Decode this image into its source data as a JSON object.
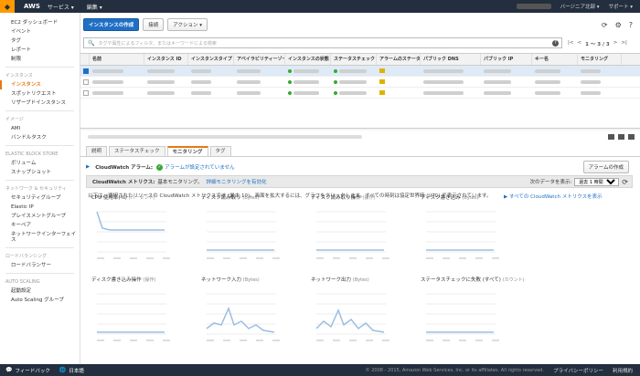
{
  "topbar": {
    "brand": "AWS",
    "services": "サービス ▾",
    "edit": "編集 ▾",
    "region": "バージニア北部 ▾",
    "support": "サポート ▾"
  },
  "sidebar": {
    "items": [
      {
        "label": "EC2 ダッシュボード",
        "type": "item"
      },
      {
        "label": "イベント",
        "type": "item"
      },
      {
        "label": "タグ",
        "type": "item"
      },
      {
        "label": "レポート",
        "type": "item"
      },
      {
        "label": "制限",
        "type": "item"
      },
      {
        "label": "インスタンス",
        "type": "head"
      },
      {
        "label": "インスタンス",
        "type": "active"
      },
      {
        "label": "スポットリクエスト",
        "type": "item"
      },
      {
        "label": "リザーブドインスタンス",
        "type": "item"
      },
      {
        "label": "イメージ",
        "type": "head"
      },
      {
        "label": "AMI",
        "type": "item"
      },
      {
        "label": "バンドルタスク",
        "type": "item"
      },
      {
        "label": "ELASTIC BLOCK STORE",
        "type": "head"
      },
      {
        "label": "ボリューム",
        "type": "item"
      },
      {
        "label": "スナップショット",
        "type": "item"
      },
      {
        "label": "ネットワーク & セキュリティ",
        "type": "head"
      },
      {
        "label": "セキュリティグループ",
        "type": "item"
      },
      {
        "label": "Elastic IP",
        "type": "item"
      },
      {
        "label": "プレイスメントグループ",
        "type": "item"
      },
      {
        "label": "キーペア",
        "type": "item"
      },
      {
        "label": "ネットワークインターフェイス",
        "type": "item"
      },
      {
        "label": "ロードバランシング",
        "type": "head"
      },
      {
        "label": "ロードバランサー",
        "type": "item"
      },
      {
        "label": "AUTO SCALING",
        "type": "head"
      },
      {
        "label": "起動設定",
        "type": "item"
      },
      {
        "label": "Auto Scaling グループ",
        "type": "item"
      }
    ]
  },
  "toolbar": {
    "launch": "インスタンスの作成",
    "connect": "接続",
    "actions": "アクション ▾"
  },
  "search": {
    "placeholder": "タグや属性によるフィルタ、またはキーワードによる検索"
  },
  "pager": {
    "text": "1 ～ 3 / 3"
  },
  "table": {
    "columns": [
      "名前",
      "インスタンス ID",
      "インスタンスタイプ",
      "アベイラビリティーゾーン",
      "インスタンスの状態",
      "ステータスチェック",
      "アラームのステータス",
      "パブリック DNS",
      "パブリック IP",
      "キー名",
      "モニタリング"
    ],
    "rows": [
      {
        "selected": true
      },
      {
        "selected": false
      },
      {
        "selected": false
      }
    ]
  },
  "detail": {
    "tabs": [
      "説明",
      "ステータスチェック",
      "モニタリング",
      "タグ"
    ],
    "active_tab": "モニタリング",
    "alarm_label": "CloudWatch アラーム:",
    "alarm_status": "アラームが設定されていません",
    "create_alarm": "アラームの作成",
    "cw_label": "CloudWatch メトリクス:",
    "cw_basic": "基本モニタリング。",
    "cw_enable": "詳細モニタリングを有効化",
    "show_data_label": "次のデータを表示:",
    "range_value": "過去 1 時間",
    "info": "以下は、選択されたリソースの CloudWatch メトリクスです (最大 10)。画面を拡大するには、グラフをクリックします。すべての時刻は協定世界時 (UTC) で表示されています。",
    "all_metrics": "▶ すべての CloudWatch メトリクスを表示"
  },
  "charts": [
    {
      "title": "CPU 使用率(%)",
      "unit": "(パーセント)"
    },
    {
      "title": "ディスク読み取り",
      "unit": "(Bytes)"
    },
    {
      "title": "ディスク読み取り操作",
      "unit": "(操作)"
    },
    {
      "title": "ディスク書き込み",
      "unit": "(Bytes)"
    },
    {
      "title": "ディスク書き込み操作",
      "unit": "(操作)"
    },
    {
      "title": "ネットワーク入力",
      "unit": "(Bytes)"
    },
    {
      "title": "ネットワーク出力",
      "unit": "(Bytes)"
    },
    {
      "title": "ステータスチェックに失敗 (すべて)",
      "unit": "(カウント)"
    }
  ],
  "footer": {
    "feedback": "フィードバック",
    "language": "日本語",
    "copyright": "© 2008 - 2015, Amazon Web Services, Inc. or its affiliates. All rights reserved.",
    "privacy": "プライバシーポリシー",
    "terms": "利用規約"
  }
}
